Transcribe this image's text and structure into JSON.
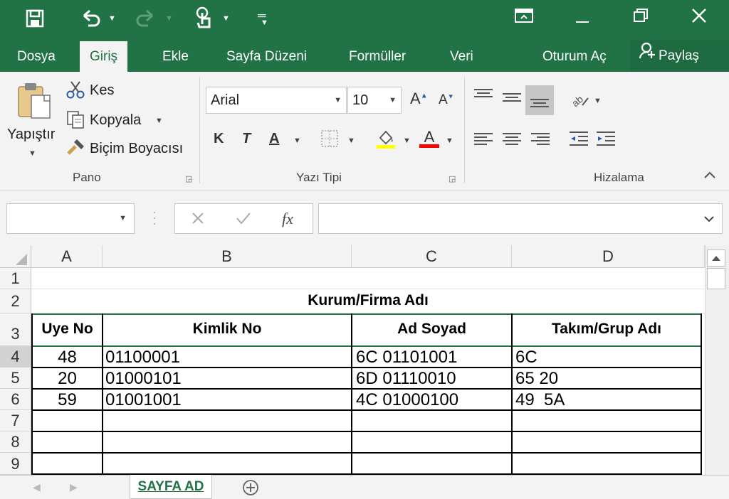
{
  "colors": {
    "excel_green": "#217346",
    "ribbon_bg": "#f3f3f3",
    "highlight_yellow": "#ffff00",
    "font_red": "#ff0000"
  },
  "tabs": [
    "Dosya",
    "Giriş",
    "Ekle",
    "Sayfa Düzeni",
    "Formüller",
    "Veri",
    "Oturum Aç"
  ],
  "share_label": "Paylaş",
  "clipboard": {
    "paste": "Yapıştır",
    "cut": "Kes",
    "copy": "Kopyala",
    "format_painter": "Biçim Boyacısı",
    "group": "Pano"
  },
  "font": {
    "name": "Arial",
    "size": "10",
    "bold": "K",
    "italic": "T",
    "underline": "A",
    "color_letter": "A",
    "group": "Yazı Tipi"
  },
  "alignment": {
    "group": "Hizalama"
  },
  "formula_bar": {
    "name_box": "",
    "fx": "fx",
    "value": ""
  },
  "columns": [
    "A",
    "B",
    "C",
    "D"
  ],
  "rows": [
    "1",
    "2",
    "3",
    "4",
    "5",
    "6",
    "7",
    "8",
    "9"
  ],
  "sheet": {
    "title": "Kurum/Firma Adı",
    "headers": [
      "Uye No",
      "Kimlik No",
      "Ad Soyad",
      "Takım/Grup Adı"
    ],
    "data": [
      [
        "48",
        "01100001",
        "6C 01101001",
        "6C"
      ],
      [
        "20",
        "01000101",
        "6D 01110010",
        "65 20"
      ],
      [
        "59",
        "01001001",
        "4C 01000100",
        "49  5A"
      ]
    ]
  },
  "sheet_tab": "SAYFA AD"
}
